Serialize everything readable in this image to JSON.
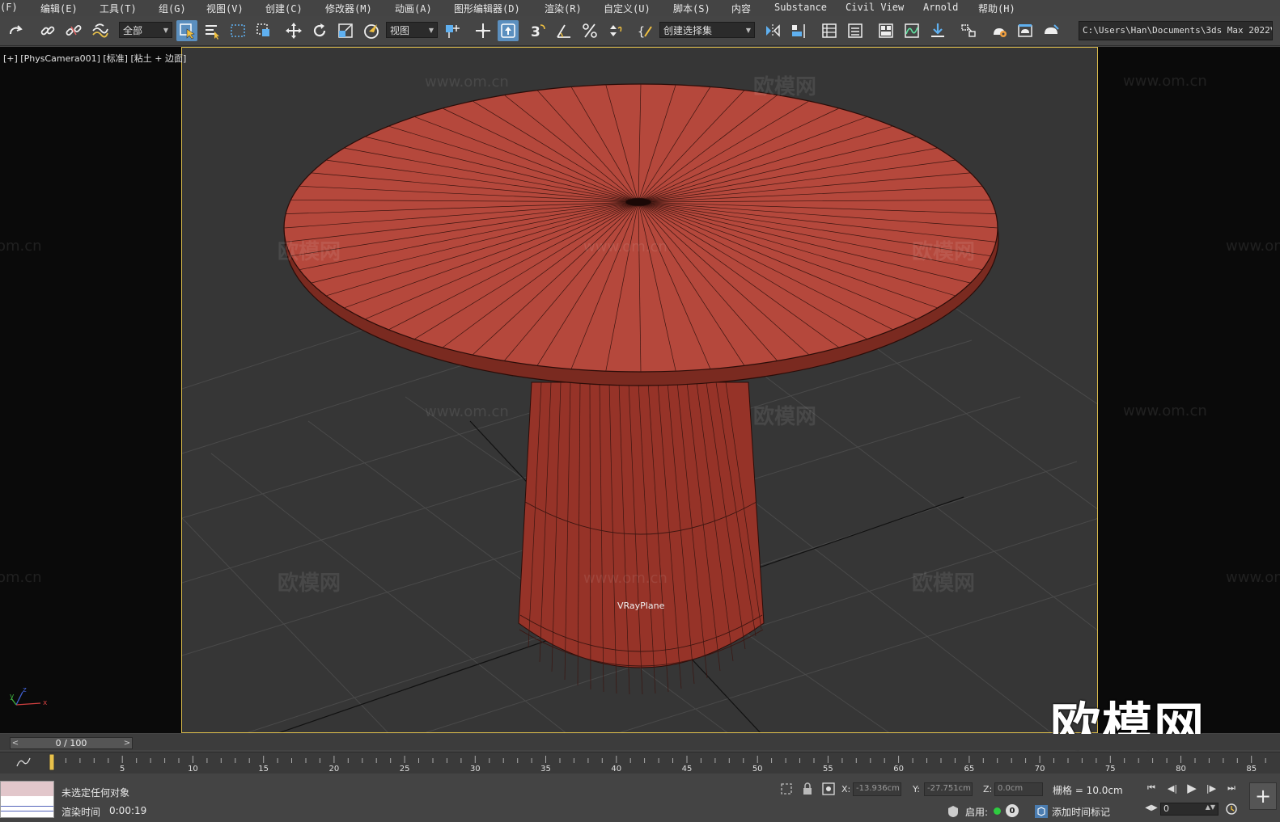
{
  "menu": [
    {
      "id": "file",
      "label": "(F)"
    },
    {
      "id": "edit",
      "label": "编辑(E)"
    },
    {
      "id": "tools",
      "label": "工具(T)"
    },
    {
      "id": "group",
      "label": "组(G)"
    },
    {
      "id": "views",
      "label": "视图(V)"
    },
    {
      "id": "create",
      "label": "创建(C)"
    },
    {
      "id": "modifiers",
      "label": "修改器(M)"
    },
    {
      "id": "animation",
      "label": "动画(A)"
    },
    {
      "id": "graph-editors",
      "label": "图形编辑器(D)"
    },
    {
      "id": "rendering",
      "label": "渲染(R)"
    },
    {
      "id": "customize",
      "label": "自定义(U)"
    },
    {
      "id": "scripting",
      "label": "脚本(S)"
    },
    {
      "id": "content",
      "label": "内容"
    },
    {
      "id": "substance",
      "label": "Substance"
    },
    {
      "id": "civil-view",
      "label": "Civil View"
    },
    {
      "id": "arnold",
      "label": "Arnold"
    },
    {
      "id": "help",
      "label": "帮助(H)"
    }
  ],
  "toolbar": {
    "selection_filter": "全部",
    "reference_coord": "视图",
    "named_selection": "创建选择集",
    "project_path": "C:\\Users\\Han\\Documents\\3ds Max 2022",
    "snap_label": "3"
  },
  "viewport": {
    "label": "[+] [PhysCamera001] [标准] [粘土 + 边面]",
    "object_label": "VRayPlane",
    "watermark_text": "欧模网",
    "watermark_url": "www.om.cn",
    "watermark_url_partial": "om.cn",
    "logo_text": "欧模网",
    "axis_x": "x",
    "axis_y": "y",
    "axis_z": "z"
  },
  "timeline": {
    "current": "0 / 100",
    "ticks": [
      "5",
      "10",
      "15",
      "20",
      "25",
      "30",
      "35",
      "40",
      "45",
      "50",
      "55",
      "60",
      "65",
      "70",
      "75",
      "80",
      "85"
    ],
    "progress": 0.0
  },
  "status": {
    "selection": "未选定任何对象",
    "render_time_label": "渲染时间",
    "render_time_value": "0:00:19",
    "x_label": "X:",
    "x_value": "-13.936cm",
    "y_label": "Y:",
    "y_value": "-27.751cm",
    "z_label": "Z:",
    "z_value": "0.0cm",
    "grid": "栅格 = 10.0cm",
    "enable": "启用:",
    "enable_count": "0",
    "add_time_tag": "添加时间标记",
    "frame_value": "0"
  },
  "colors": {
    "viewport_border": "#d8b94a",
    "table_red": "#b5483c",
    "active_button": "#5b8fbf"
  }
}
